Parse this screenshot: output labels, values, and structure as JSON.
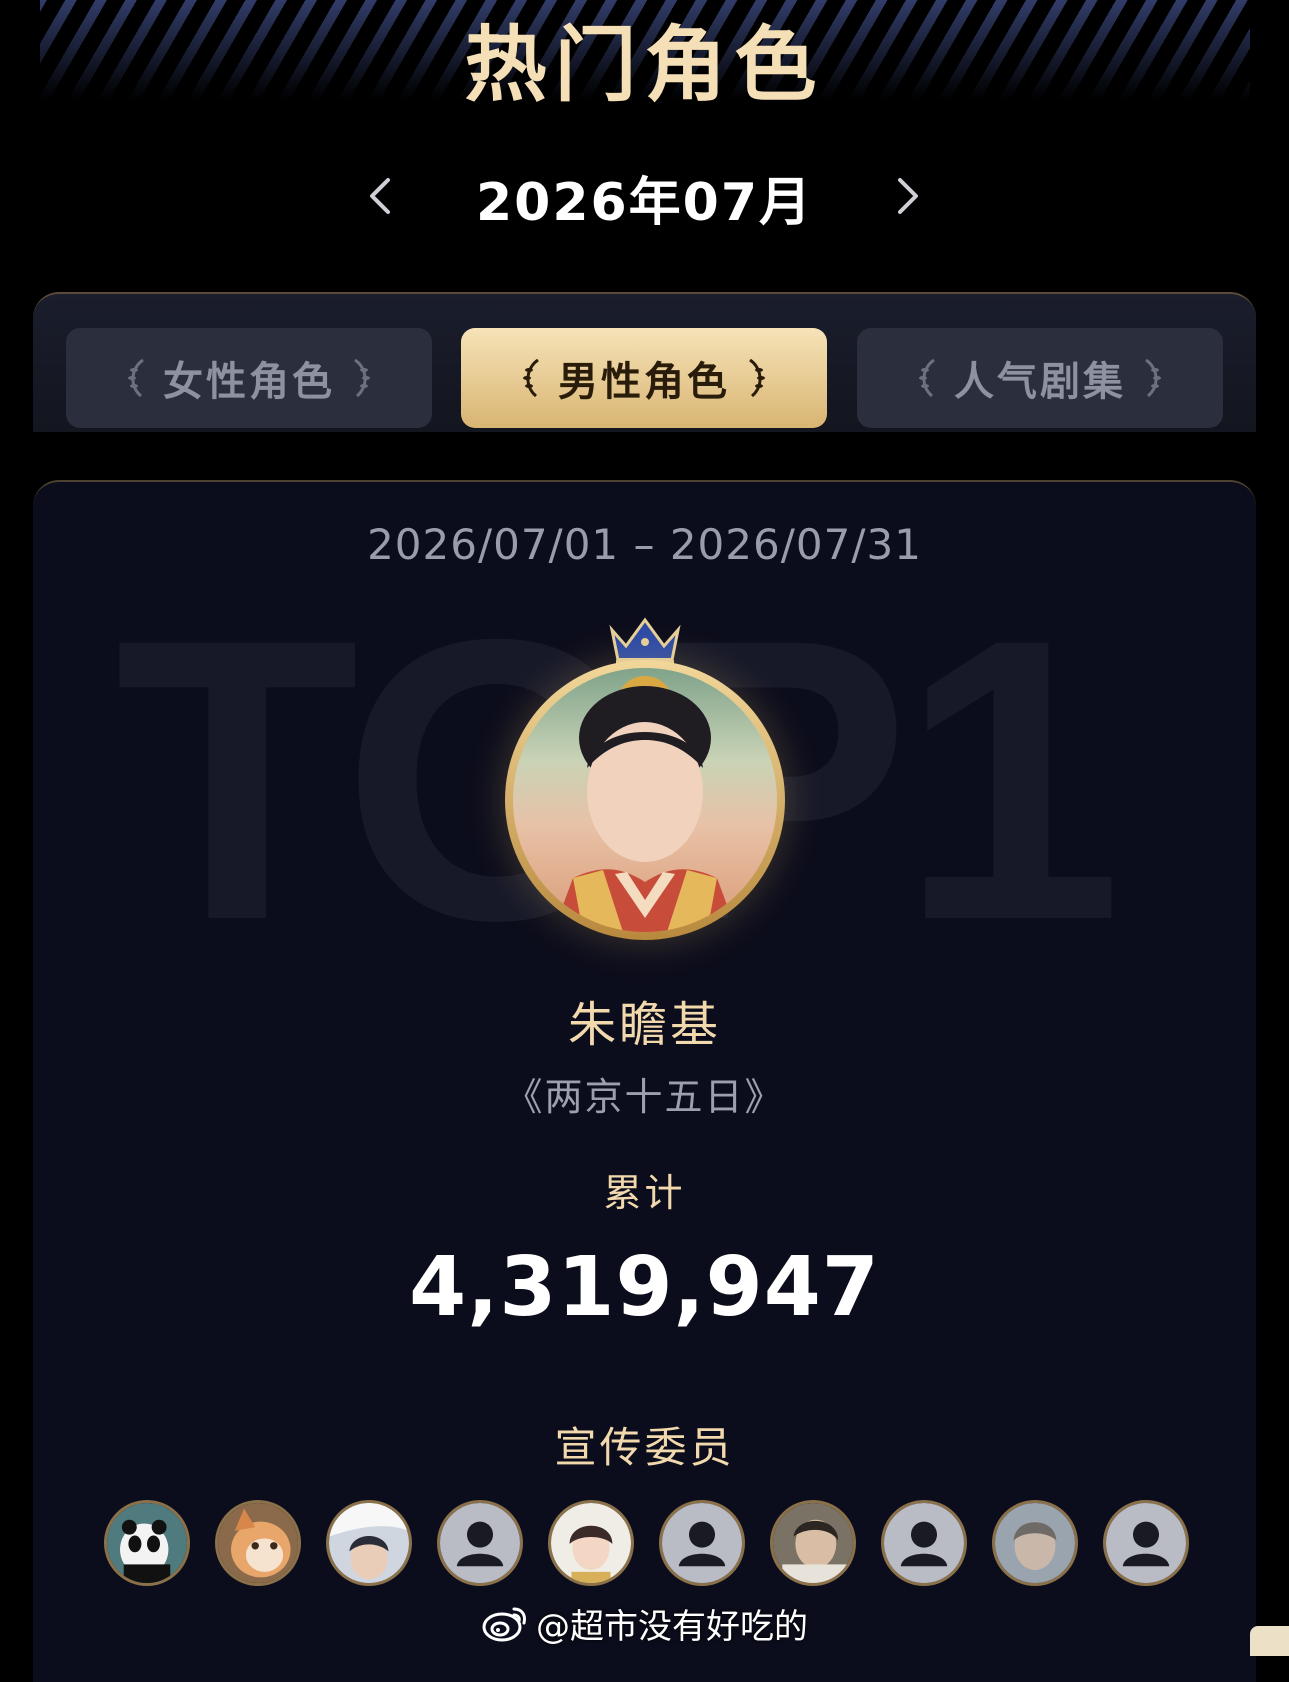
{
  "header": {
    "title": "热门角色"
  },
  "month_nav": {
    "label": "2026年07月",
    "prev_icon": "chevron-left-icon",
    "next_icon": "chevron-right-icon"
  },
  "tabs": [
    {
      "label": "女性角色",
      "active": false
    },
    {
      "label": "男性角色",
      "active": true
    },
    {
      "label": "人气剧集",
      "active": false
    }
  ],
  "ranking": {
    "date_range": "2026/07/01 – 2026/07/31",
    "rank_badge": "TOP1",
    "character_name": "朱瞻基",
    "drama": "《两京十五日》",
    "total_label": "累计",
    "total_value": "4,319,947",
    "promoters_label": "宣传委员",
    "promoters": [
      {
        "avatar": "panda-photo"
      },
      {
        "avatar": "cat-photo"
      },
      {
        "avatar": "person-photo"
      },
      {
        "avatar": "default-user-icon"
      },
      {
        "avatar": "person-photo"
      },
      {
        "avatar": "default-user-icon"
      },
      {
        "avatar": "person-photo"
      },
      {
        "avatar": "default-user-icon"
      },
      {
        "avatar": "person-photo"
      },
      {
        "avatar": "default-user-icon"
      }
    ]
  },
  "watermark": {
    "text": "@超市没有好吃的",
    "icon": "weibo-icon"
  },
  "colors": {
    "gold_text": "#f2d9ad",
    "tab_active": "#e8c98d",
    "background": "#000000",
    "card": "#0c0d1c"
  }
}
